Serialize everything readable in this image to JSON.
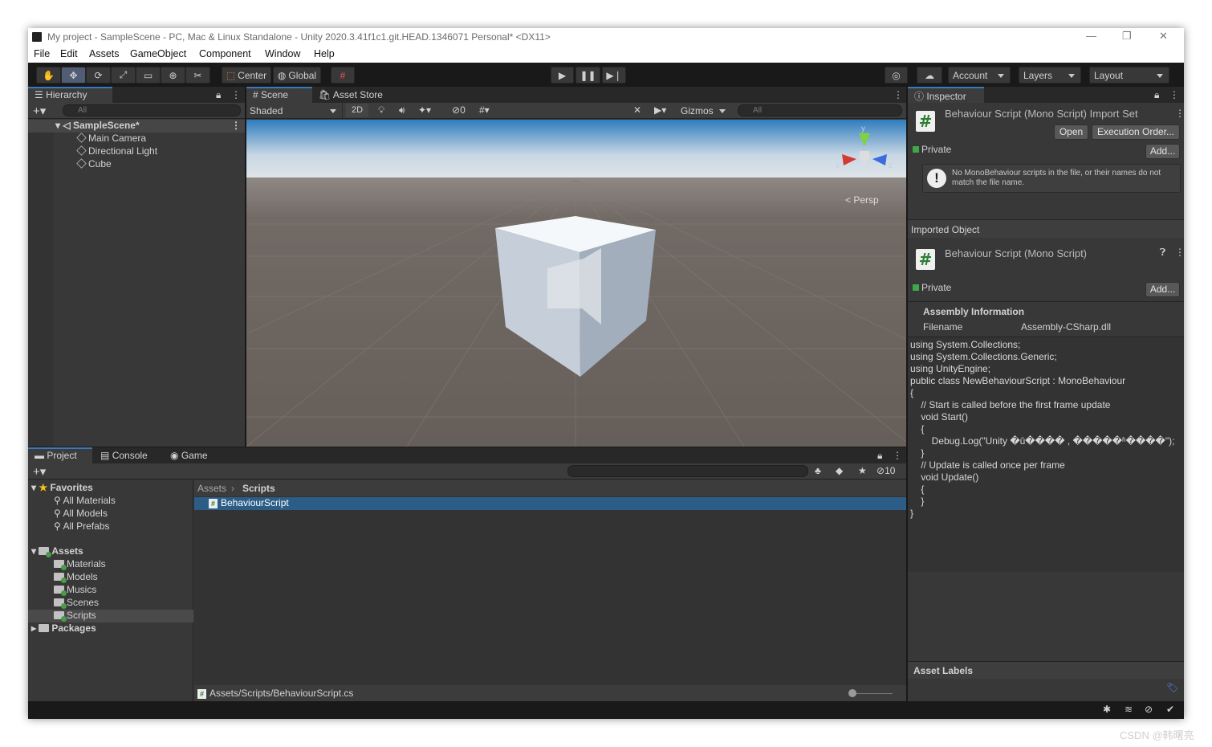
{
  "window": {
    "title": "My project - SampleScene - PC, Mac & Linux Standalone - Unity 2020.3.41f1c1.git.HEAD.1346071 Personal* <DX11>",
    "min": "—",
    "restore": "❐",
    "close": "✕"
  },
  "menu": [
    "File",
    "Edit",
    "Assets",
    "GameObject",
    "Component",
    "Window",
    "Help"
  ],
  "toolbar": {
    "center": "Center",
    "global": "Global",
    "account": "Account",
    "layers": "Layers",
    "layout": "Layout"
  },
  "hierarchy": {
    "tab": "Hierarchy",
    "search_placeholder": "All",
    "scene": "SampleScene*",
    "objects": [
      "Main Camera",
      "Directional Light",
      "Cube"
    ]
  },
  "scene": {
    "tab_scene": "Scene",
    "tab_store": "Asset Store",
    "shading": "Shaded",
    "mode2d": "2D",
    "hidden_count": "0",
    "gizmos": "Gizmos",
    "search_placeholder": "All",
    "persp": "Persp",
    "axis_y": "y",
    "axis_x": "x",
    "axis_z": "z"
  },
  "project": {
    "tab_project": "Project",
    "tab_console": "Console",
    "tab_game": "Game",
    "favorites": "Favorites",
    "fav_items": [
      "All Materials",
      "All Models",
      "All Prefabs"
    ],
    "assets": "Assets",
    "asset_folders": [
      "Materials",
      "Models",
      "Musics",
      "Scenes",
      "Scripts"
    ],
    "packages": "Packages",
    "breadcrumb_root": "Assets",
    "breadcrumb_leaf": "Scripts",
    "selected_file": "BehaviourScript",
    "footer_path": "Assets/Scripts/BehaviourScript.cs",
    "visible_count": "10"
  },
  "inspector": {
    "tab": "Inspector",
    "import_title": "Behaviour Script (Mono Script) Import Set",
    "open_btn": "Open",
    "exec_btn": "Execution Order...",
    "private": "Private",
    "add": "Add...",
    "warning": "No MonoBehaviour scripts in the file, or their names do not match the file name.",
    "imported_object": "Imported Object",
    "object_title": "Behaviour Script (Mono Script)",
    "assembly_header": "Assembly Information",
    "filename_label": "Filename",
    "filename_value": "Assembly-CSharp.dll",
    "code": [
      "using System.Collections;",
      "using System.Collections.Generic;",
      "using UnityEngine;",
      "",
      "public class NewBehaviourScript : MonoBehaviour",
      "{",
      "    // Start is called before the first frame update",
      "    void Start()",
      "    {",
      "        Debug.Log(\"Unity �û���� , �����ʱ����\");",
      "    }",
      "",
      "    // Update is called once per frame",
      "    void Update()",
      "    {",
      "",
      "    }",
      "}"
    ],
    "asset_labels": "Asset Labels"
  },
  "watermark": "CSDN @韩曙亮",
  "colors": {
    "accent": "#3a79bb",
    "selection": "#2c5d87",
    "panel": "#383838",
    "sky": "#c8d7e4",
    "ground": "#6e6661"
  }
}
